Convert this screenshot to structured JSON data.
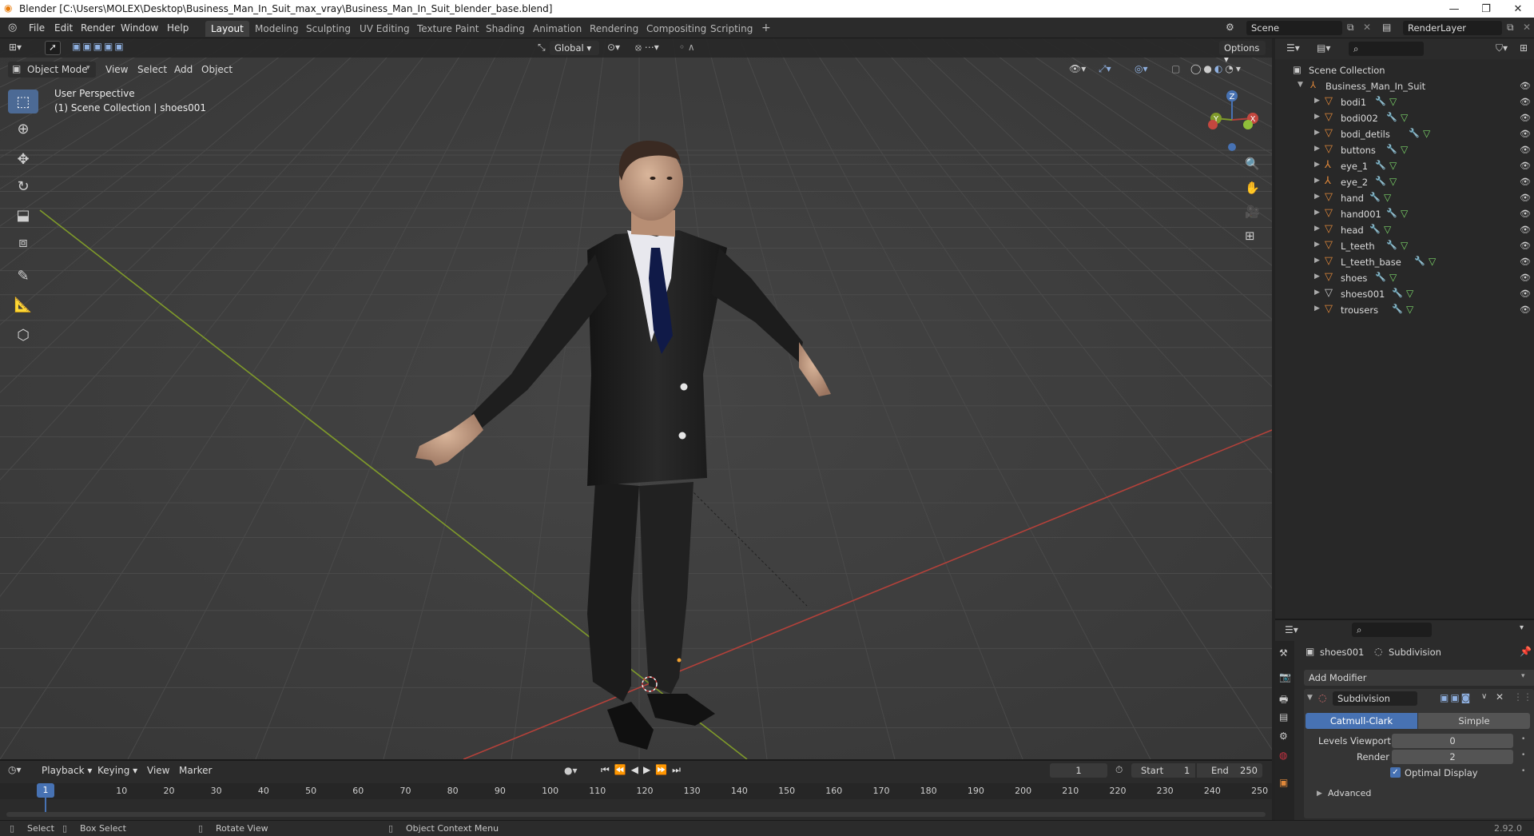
{
  "window": {
    "title": "Blender [C:\\Users\\MOLEX\\Desktop\\Business_Man_In_Suit_max_vray\\Business_Man_In_Suit_blender_base.blend]"
  },
  "menu": {
    "items": [
      "File",
      "Edit",
      "Render",
      "Window",
      "Help"
    ]
  },
  "workspaces": {
    "tabs": [
      "Layout",
      "Modeling",
      "Sculpting",
      "UV Editing",
      "Texture Paint",
      "Shading",
      "Animation",
      "Rendering",
      "Compositing",
      "Scripting"
    ],
    "active": "Layout",
    "add": "+"
  },
  "scene": {
    "name": "Scene",
    "render_layer": "RenderLayer"
  },
  "viewport_header": {
    "mode": "Object Mode",
    "menus": [
      "View",
      "Select",
      "Add",
      "Object"
    ],
    "transform_orientation": "Global",
    "options": "Options"
  },
  "viewport": {
    "perspective": "User Perspective",
    "collection_info": "(1) Scene Collection | shoes001",
    "gizmo": {
      "x": "X",
      "y": "Y",
      "z": "Z"
    }
  },
  "outliner": {
    "root": "Scene Collection",
    "group": "Business_Man_In_Suit",
    "items": [
      "bodi1",
      "bodi002",
      "bodi_detils",
      "buttons",
      "eye_1",
      "eye_2",
      "hand",
      "hand001",
      "head",
      "L_teeth",
      "L_teeth_base",
      "shoes",
      "shoes001",
      "trousers"
    ]
  },
  "properties": {
    "object": "shoes001",
    "modifier_crumb": "Subdivision",
    "add_modifier": "Add Modifier",
    "modifier_name": "Subdivision",
    "type_catmull": "Catmull-Clark",
    "type_simple": "Simple",
    "levels_viewport_label": "Levels Viewport",
    "levels_viewport_value": "0",
    "render_label": "Render",
    "render_value": "2",
    "optimal_display": "Optimal Display",
    "advanced": "Advanced"
  },
  "timeline": {
    "menus": [
      "Playback",
      "Keying",
      "View",
      "Marker"
    ],
    "current_frame": "1",
    "start_label": "Start",
    "start_value": "1",
    "end_label": "End",
    "end_value": "250",
    "ticks": [
      "10",
      "20",
      "30",
      "40",
      "50",
      "60",
      "70",
      "80",
      "90",
      "100",
      "110",
      "120",
      "130",
      "140",
      "150",
      "160",
      "170",
      "180",
      "190",
      "200",
      "210",
      "220",
      "230",
      "240",
      "250"
    ],
    "playhead": "1"
  },
  "statusbar": {
    "select": "Select",
    "box_select": "Box Select",
    "rotate_view": "Rotate View",
    "context_menu": "Object Context Menu",
    "version": "2.92.0"
  },
  "colors": {
    "accent": "#4c6a95",
    "active_blue": "#4772b3",
    "mesh_orange": "#e0883a",
    "axis_red": "#b3413a",
    "axis_green": "#7f9a2a"
  }
}
